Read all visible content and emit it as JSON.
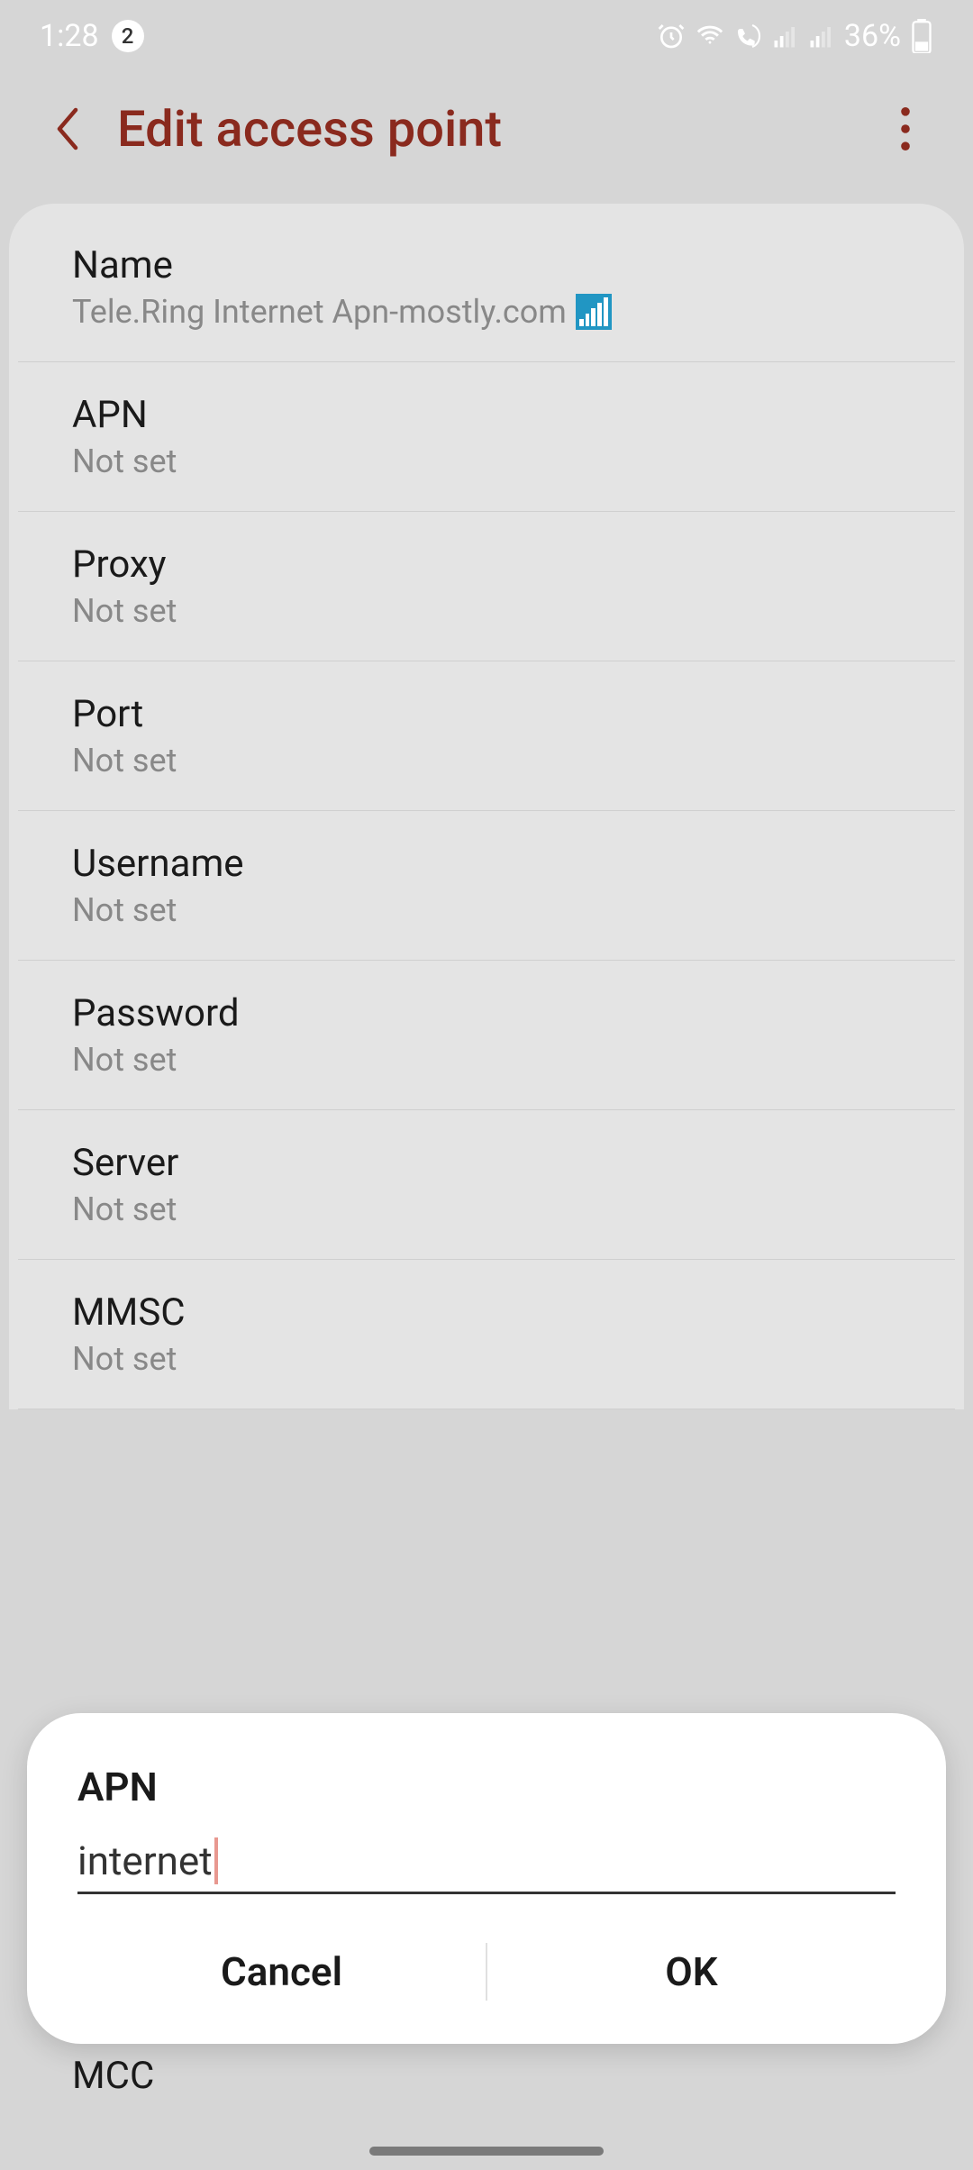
{
  "status": {
    "time": "1:28",
    "notif_count": "2",
    "battery": "36%"
  },
  "header": {
    "title": "Edit access point"
  },
  "settings": [
    {
      "label": "Name",
      "value": "Tele.Ring Internet Apn-mostly.com",
      "has_icon": true
    },
    {
      "label": "APN",
      "value": "Not set"
    },
    {
      "label": "Proxy",
      "value": "Not set"
    },
    {
      "label": "Port",
      "value": "Not set"
    },
    {
      "label": "Username",
      "value": "Not set"
    },
    {
      "label": "Password",
      "value": "Not set"
    },
    {
      "label": "Server",
      "value": "Not set"
    },
    {
      "label": "MMSC",
      "value": "Not set"
    }
  ],
  "peek_label": "MCC",
  "dialog": {
    "title": "APN",
    "input_value": "internet",
    "cancel": "Cancel",
    "ok": "OK"
  }
}
